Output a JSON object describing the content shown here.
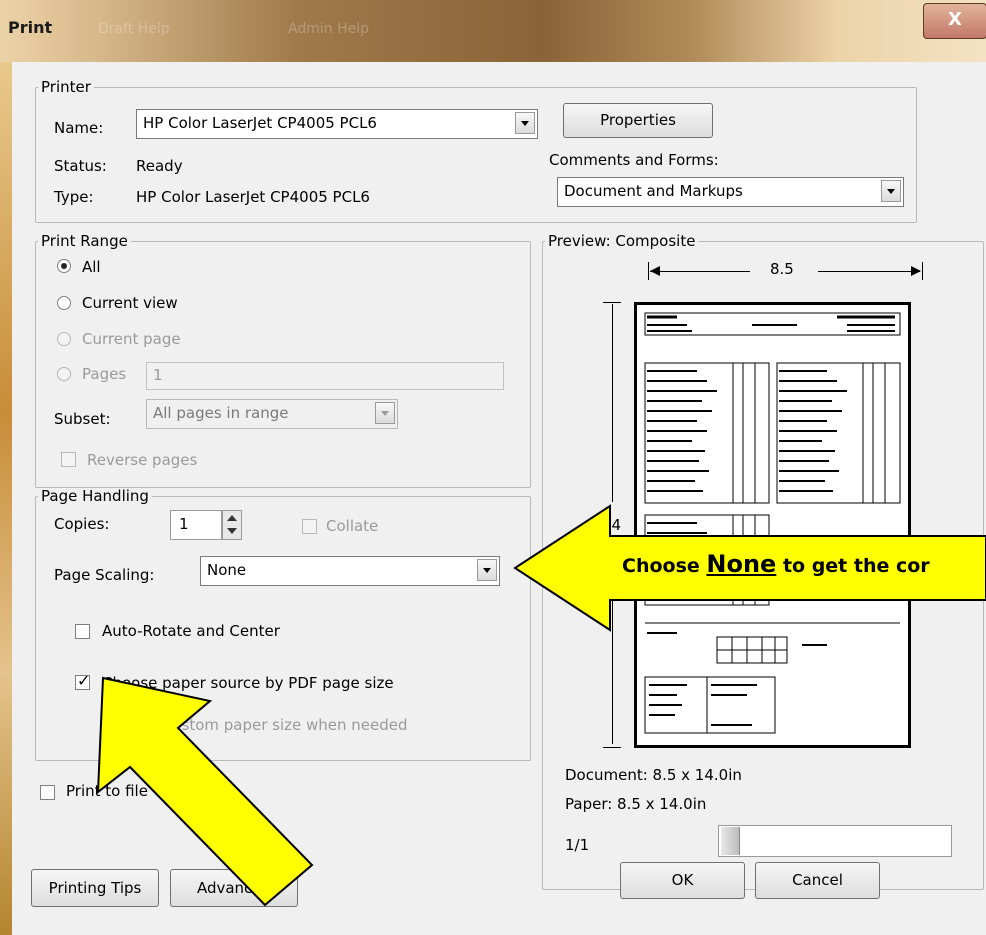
{
  "window": {
    "title": "Print",
    "close_label": "X",
    "background_tab_1": "Draft Help",
    "background_tab_2": "Admin Help"
  },
  "printer": {
    "legend": "Printer",
    "name_label": "Name:",
    "name_value": "HP Color LaserJet CP4005 PCL6",
    "status_label": "Status:",
    "status_value": "Ready",
    "type_label": "Type:",
    "type_value": "HP Color LaserJet CP4005 PCL6",
    "properties_button": "Properties",
    "comments_label": "Comments and Forms:",
    "comments_value": "Document and Markups"
  },
  "print_range": {
    "legend": "Print Range",
    "all": "All",
    "current_view": "Current view",
    "current_page": "Current page",
    "pages": "Pages",
    "pages_value": "1",
    "subset_label": "Subset:",
    "subset_value": "All pages in range",
    "reverse_pages": "Reverse pages",
    "selected": "All"
  },
  "page_handling": {
    "legend": "Page Handling",
    "copies_label": "Copies:",
    "copies_value": "1",
    "collate": "Collate",
    "scaling_label": "Page Scaling:",
    "scaling_value": "None",
    "auto_rotate": "Auto-Rotate and Center",
    "choose_paper_source": "Choose paper source by PDF page size",
    "choose_paper_source_checked": true,
    "custom_paper": "ustom paper size when needed"
  },
  "print_to_file": "Print to file",
  "preview": {
    "legend": "Preview: Composite",
    "width_label": "8.5",
    "height_label": "14",
    "document_size": "Document: 8.5 x 14.0in",
    "paper_size": "Paper: 8.5 x 14.0in",
    "page_counter": "1/1"
  },
  "buttons": {
    "printing_tips": "Printing Tips",
    "advanced": "Advanced",
    "ok": "OK",
    "cancel": "Cancel"
  },
  "callout": {
    "text_before": "Choose ",
    "text_highlight": "None",
    "text_after": " to get the cor",
    "color": "#ffff00"
  }
}
